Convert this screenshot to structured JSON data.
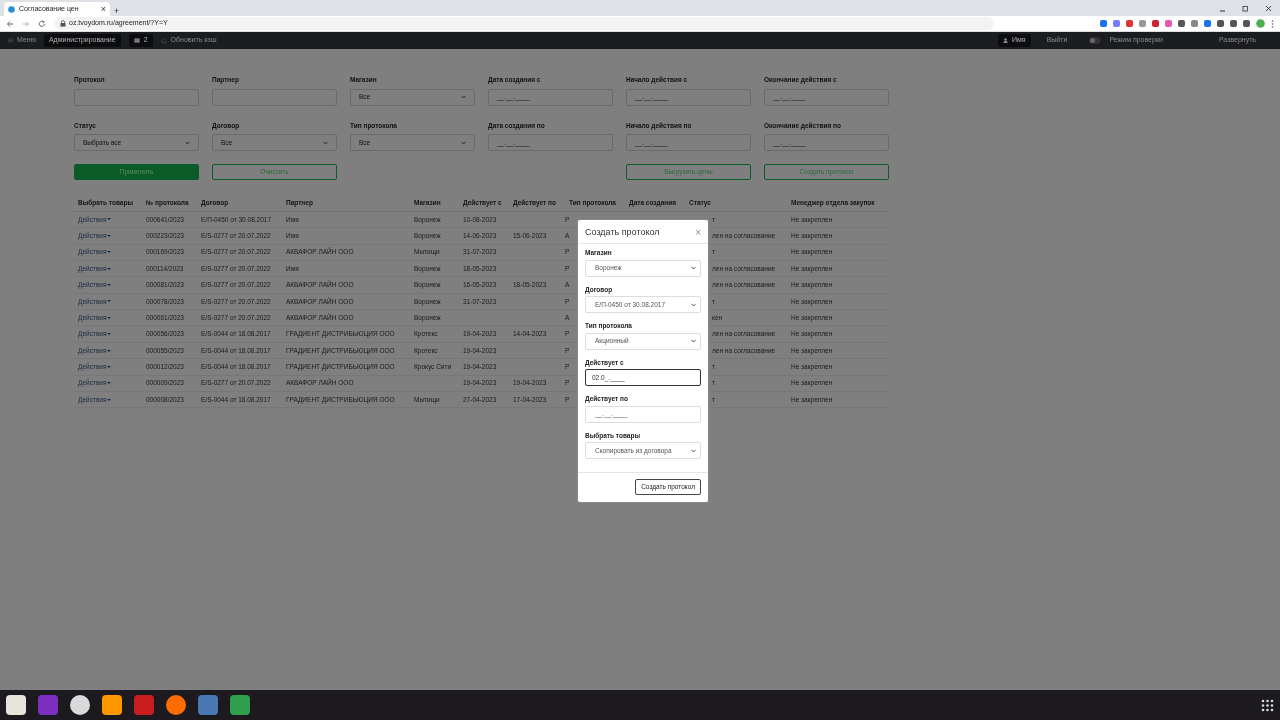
{
  "browser": {
    "tab_title": "Согласование цен",
    "tab_close": "×",
    "new_tab": "+",
    "url": "oz.tvoydom.ru/agreement/?Y=Y"
  },
  "navbar": {
    "menu": "Меню",
    "admin": "Администрирование",
    "badge": "2",
    "refresh": "Обновить кэш",
    "user": "Имя",
    "logout": "Выйти",
    "mode_label": "Режим проверки",
    "mode_on": false,
    "expand": "Развернуть"
  },
  "filters": [
    {
      "label": "Протокол",
      "kind": "text"
    },
    {
      "label": "Партнер",
      "kind": "text"
    },
    {
      "label": "Магазин",
      "kind": "select",
      "value": "Все"
    },
    {
      "label": "Дата создания с",
      "kind": "date",
      "placeholder": "__.__.____"
    },
    {
      "label": "Начало действия с",
      "kind": "date",
      "placeholder": "__.__.____"
    },
    {
      "label": "Окончание действия с",
      "kind": "date",
      "placeholder": "__.__.____"
    },
    {
      "label": "Статус",
      "kind": "select",
      "value": "Выбрать все"
    },
    {
      "label": "Договор",
      "kind": "select",
      "value": "Все"
    },
    {
      "label": "Тип протокола",
      "kind": "select",
      "value": "Все"
    },
    {
      "label": "Дата создания по",
      "kind": "date",
      "placeholder": "__.__.____"
    },
    {
      "label": "Начало действия по",
      "kind": "date",
      "placeholder": "__.__.____"
    },
    {
      "label": "Окончание действия по",
      "kind": "date",
      "placeholder": "__.__.____"
    }
  ],
  "buttons_left": [
    {
      "label": "Применить",
      "kind": "filled"
    },
    {
      "label": "Очистить",
      "kind": "outline"
    }
  ],
  "buttons_right": [
    {
      "label": "Выгрузить цены",
      "kind": "outline"
    },
    {
      "label": "Создать протокол",
      "kind": "outline"
    }
  ],
  "table": {
    "columns": [
      "Выбрать товары",
      "№ протокола",
      "Договор",
      "Партнер",
      "Магазин",
      "Действует с",
      "Действует по",
      "Тип протокола",
      "Дата создания",
      "Статус",
      "Менеджер отдела закупок"
    ],
    "rows": [
      {
        "action": "Действия",
        "number": "000641/2023",
        "contract": "Е/П-0450 от 30.08.2017",
        "partner": "Имя",
        "store": "Воронеж",
        "from": "10-08-2023",
        "type": "Р",
        "status": "т",
        "manager": "Не закреплен"
      },
      {
        "action": "Действия",
        "number": "000223/2023",
        "contract": "E/S-0277 от 20.07.2022",
        "partner": "Имя",
        "store": "Воронеж",
        "from": "14-06-2023",
        "to": "15-06-2023",
        "type": "А",
        "status": "лен на согласование",
        "manager": "Не закреплен"
      },
      {
        "action": "Действия",
        "number": "000169/2023",
        "contract": "E/S-0277 от 20.07.2022",
        "partner": "АКВАФОР ЛАЙН ООО",
        "store": "Мытищи",
        "from": "31-07-2023",
        "type": "Р",
        "status": "т",
        "manager": "Не закреплен"
      },
      {
        "action": "Действия",
        "number": "000114/2023",
        "contract": "E/S-0277 от 20.07.2022",
        "partner": "Имя",
        "store": "Воронеж",
        "from": "18-05-2023",
        "type": "Р",
        "status": "лен на согласование",
        "manager": "Не закреплен"
      },
      {
        "action": "Действия",
        "number": "000081/2023",
        "contract": "E/S-0277 от 20.07.2022",
        "partner": "АКВАФОР ЛАЙН ООО",
        "store": "Воронеж",
        "from": "16-05-2023",
        "to": "18-05-2023",
        "type": "А",
        "status": "лен на согласование",
        "manager": "Не закреплен"
      },
      {
        "action": "Действия",
        "number": "000078/2023",
        "contract": "E/S-0277 от 20.07.2022",
        "partner": "АКВАФОР ЛАЙН ООО",
        "store": "Воронеж",
        "from": "31-07-2023",
        "type": "Р",
        "status": "т",
        "manager": "Не закреплен"
      },
      {
        "action": "Действия",
        "number": "000061/2023",
        "contract": "E/S-0277 от 20.07.2022",
        "partner": "АКВАФОР ЛАЙН ООО",
        "store": "Воронеж",
        "type": "А",
        "status": "кен",
        "manager": "Не закреплен"
      },
      {
        "action": "Действия",
        "number": "000056/2023",
        "contract": "E/S-0044 от 18.08.2017",
        "partner": "ГРАДИЕНТ ДИСТРИБЬЮЦИЯ ООО",
        "store": "Кротекс",
        "from": "19-04-2023",
        "to": "14-04-2023",
        "type": "Р",
        "status": "лен на согласование",
        "manager": "Не закреплен"
      },
      {
        "action": "Действия",
        "number": "000055/2023",
        "contract": "E/S-0044 от 18.08.2017",
        "partner": "ГРАДИЕНТ ДИСТРИБЬЮЦИЯ ООО",
        "store": "Кротекс",
        "from": "19-04-2023",
        "type": "Р",
        "status": "лен на согласование",
        "manager": "Не закреплен"
      },
      {
        "action": "Действия",
        "number": "000012/2023",
        "contract": "E/S-0044 от 18.08.2017",
        "partner": "ГРАДИЕНТ ДИСТРИБЬЮЦИЯ ООО",
        "store": "Крокус Сити",
        "from": "19-04-2023",
        "type": "Р",
        "status": "т",
        "manager": "Не закреплен"
      },
      {
        "action": "Действия",
        "number": "000009/2023",
        "contract": "E/S-0277 от 20.07.2022",
        "partner": "АКВАФОР ЛАЙН ООО",
        "from": "19-04-2023",
        "to": "19-04-2023",
        "type": "Р",
        "status": "т",
        "manager": "Не закреплен"
      },
      {
        "action": "Действия",
        "number": "000008/2023",
        "contract": "E/S-0044 от 18.08.2017",
        "partner": "ГРАДИЕНТ ДИСТРИБЬЮЦИЯ ООО",
        "store": "Мытищи",
        "from": "27-04-2023",
        "to": "17-04-2023",
        "type": "Р",
        "status": "т",
        "manager": "Не закреплен"
      }
    ]
  },
  "modal": {
    "title": "Создать протокол",
    "close": "×",
    "fields": [
      {
        "label": "Магазин",
        "kind": "select",
        "value": "Воронеж",
        "focused": false
      },
      {
        "label": "Договор",
        "kind": "select",
        "value": "Е/П-0450 от 30.08.2017",
        "focused": false
      },
      {
        "label": "Тип протокола",
        "kind": "select",
        "value": "Акционный",
        "focused": false
      },
      {
        "label": "Действует с",
        "kind": "date",
        "value": "02.0_.____",
        "focused": true
      },
      {
        "label": "Действует по",
        "kind": "date",
        "placeholder": "__.__.____",
        "focused": false
      },
      {
        "label": "Выбрать товары",
        "kind": "select",
        "value": "Скопировать из договора",
        "focused": false
      }
    ],
    "submit": "Создать протокол"
  }
}
